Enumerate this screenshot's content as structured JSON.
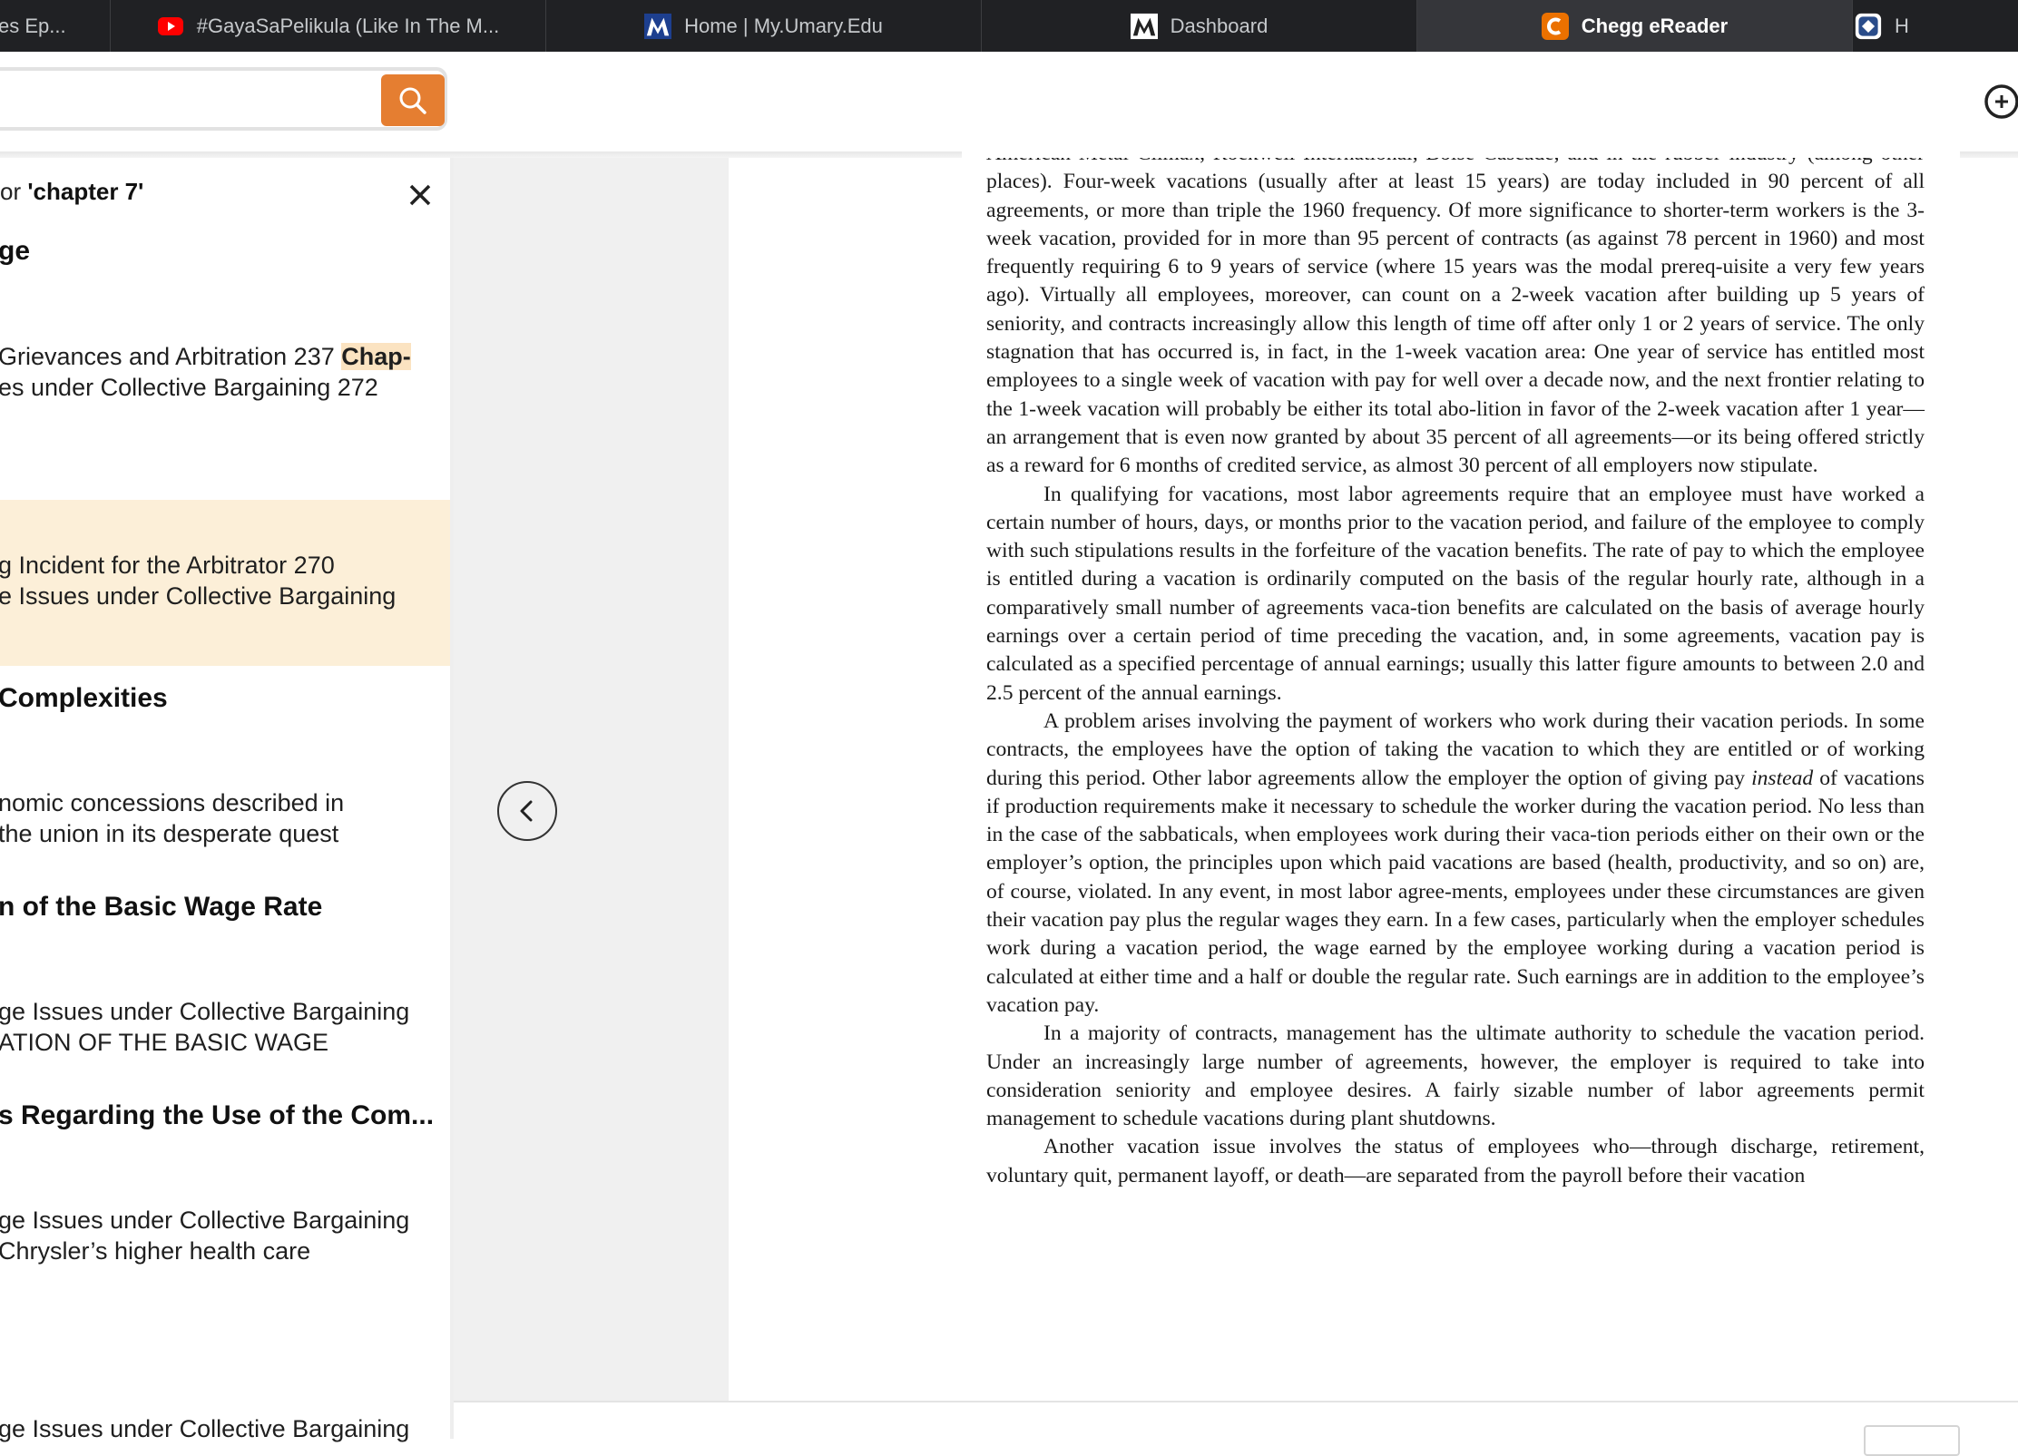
{
  "tabs": [
    {
      "label": "es Ep...",
      "favicon": "none"
    },
    {
      "label": "#GayaSaPelikula (Like In The M...",
      "favicon": "youtube-icon"
    },
    {
      "label": "Home | My.Umary.Edu",
      "favicon": "umary-icon"
    },
    {
      "label": "Dashboard",
      "favicon": "umary-icon"
    },
    {
      "label": "Chegg eReader",
      "favicon": "chegg-icon",
      "active": true
    },
    {
      "label": "H",
      "favicon": "generic-icon"
    }
  ],
  "colors": {
    "accent": "#e57e31",
    "highlight_band": "#fcefd8",
    "tabbar": "#202124"
  },
  "search": {
    "results_prefix": "or ",
    "results_query": "'chapter 7'"
  },
  "sidebar": {
    "results": [
      {
        "heading": "ge",
        "lines": [
          "Grievances and Arbitration 237 ",
          "es under Collective Bargaining 272"
        ],
        "hit": "Chap-"
      },
      {
        "heading": "",
        "lines": [
          "g Incident for the Arbitrator 270",
          "e Issues under Collective Bargaining"
        ]
      },
      {
        "heading": " Complexities",
        "lines": [
          "nomic concessions described in",
          " the union in its desperate quest"
        ]
      },
      {
        "heading": "n of the Basic Wage Rate",
        "lines": [
          "ge Issues under Collective Bargaining",
          "ATION OF THE BASIC WAGE"
        ]
      },
      {
        "heading": "s Regarding the Use of the Com...",
        "lines": [
          "ge Issues under Collective Bargaining",
          " Chrysler’s higher health care"
        ]
      },
      {
        "heading": "",
        "lines": [
          "ge Issues under Collective Bargaining"
        ]
      }
    ]
  },
  "reader": {
    "paragraphs": [
      {
        "indent": false,
        "text": "American Metal Climax, Rockwell International, Boise Cascade, and in the rubber industry (among other places). Four-week vacations (usually after at least 15 years) are today included in 90 percent of all agreements, or more than triple the 1960 frequency. Of more significance to shorter-term workers is the 3-week vacation, provided for in more than 95 percent of contracts (as against 78 percent in 1960) and most frequently requiring 6 to 9 years of service (where 15 years was the modal prereq-uisite a very few years ago). Virtually all employees, moreover, can count on a 2-week vacation after building up 5 years of seniority, and contracts increasingly allow this length of time off after only 1 or 2 years of service. The only stagnation that has occurred is, in fact, in the 1-week vacation area: One year of service has entitled most employees to a single week of vacation with pay for well over a decade now, and the next frontier relating to the 1-week vacation will probably be either its total abo-lition in favor of the 2-week vacation after 1 year—an arrangement that is even now granted by about 35 percent of all agreements—or its being offered strictly as a reward for 6 months of credited service, as almost 30 percent of all employers now stipulate."
      },
      {
        "indent": true,
        "text": "In qualifying for vacations, most labor agreements require that an employee must have worked a certain number of hours, days, or months prior to the vacation period, and failure of the employee to comply with such stipulations results in the forfeiture of the vacation benefits. The rate of pay to which the employee is entitled during a vacation is ordinarily computed on the basis of the regular hourly rate, although in a comparatively small number of agreements vaca-tion benefits are calculated on the basis of average hourly earnings over a certain period of time preceding the vacation, and, in some agreements, vacation pay is calculated as a specified percentage of annual earnings; usually this latter figure amounts to between 2.0 and 2.5 percent of the annual earnings."
      },
      {
        "indent": true,
        "text_before": "A problem arises involving the payment of workers who work during their vacation periods. In some contracts, the employees have the option of taking the vacation to which they are entitled or of working during this period. Other labor agreements allow the employer the option of giving pay ",
        "italic": "instead",
        "text_after": " of vacations if production requirements make it necessary to schedule the worker during the vacation period. No less than in the case of the sabbaticals, when employees work during their vaca-tion periods either on their own or the employer’s option, the principles upon which paid vacations are based (health, productivity, and so on) are, of course, violated. In any event, in most labor agree-ments, employees under these circumstances are given their vacation pay plus the regular wages they earn. In a few cases, particularly when the employer schedules work during a vacation period, the wage earned by the employee working during a vacation period is calculated at either time and a half or double the regular rate. Such earnings are in addition to the employee’s vacation pay."
      },
      {
        "indent": true,
        "text": "In a majority of contracts, management has the ultimate authority to schedule the vacation period. Under an increasingly large number of agreements, however, the employer is required to take into consideration seniority and employee desires. A fairly sizable number of labor agreements permit management to schedule vacations during plant shutdowns."
      },
      {
        "indent": true,
        "text": "Another vacation issue involves the status of employees who—through discharge, retirement, voluntary quit, permanent layoff, or death—are separated from the payroll before their vacation"
      }
    ]
  }
}
